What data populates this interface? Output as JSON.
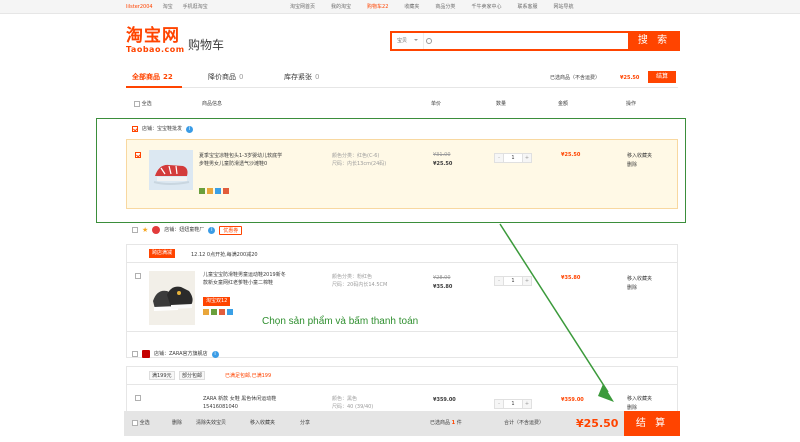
{
  "topbar": {
    "username": "lilster2004",
    "home": "淘宝",
    "mobile": "手机逛淘宝",
    "links": [
      "淘宝网首页",
      "我的淘宝",
      "购物车22",
      "收藏夹",
      "商品分类",
      "千牛卖家中心",
      "联系客服",
      "网站导航"
    ]
  },
  "header": {
    "logo_cn": "淘宝网",
    "logo_en": "Taobao.com",
    "cart_title": "购物车",
    "search_category": "宝贝",
    "search_button": "搜 索"
  },
  "tabs": [
    {
      "label": "全部商品",
      "count": "22"
    },
    {
      "label": "降价商品",
      "count": "0"
    },
    {
      "label": "库存紧张",
      "count": "0"
    }
  ],
  "summary": {
    "label": "已选商品（不含运费）",
    "amount": "¥25.50",
    "pay": "结算"
  },
  "columns": {
    "select_all": "全选",
    "info": "商品信息",
    "price": "单价",
    "qty": "数量",
    "amount": "金额",
    "ops": "操作"
  },
  "stores": [
    {
      "label": "店铺：宝宝鞋批发",
      "coupon": ""
    },
    {
      "label": "店铺：妞妞童鞋厂",
      "coupon": "优惠券"
    },
    {
      "label": "店铺：ZARA官方旗舰店",
      "coupon": ""
    }
  ],
  "promo_banner": {
    "tag": "跨店满减",
    "text": "12.12 0点开抢,每满200减20"
  },
  "items": [
    {
      "name": "夏季宝宝凉鞋包头1-3岁婴幼儿软底学步鞋男女儿童防滑透气沙滩鞋0",
      "props": [
        "颜色分类：红色(C-6)",
        "尺码：内长13cm(24码)"
      ],
      "old_price": "¥31.00",
      "price": "¥25.50",
      "qty": "1",
      "sum": "¥25.50",
      "ops": [
        "移入收藏夹",
        "删除"
      ]
    },
    {
      "name": "儿童宝宝防滑鞋男童运动鞋2019新冬款新女童网红老爹鞋小童二棉鞋",
      "props": [
        "颜色分类：粉红色",
        "尺码：20码内长14.5CM"
      ],
      "old_price": "¥28.00",
      "price": "¥35.80",
      "qty": "1",
      "sum": "¥35.80",
      "badge": "淘宝双12",
      "ops": [
        "移入收藏夹",
        "删除"
      ]
    },
    {
      "name": "ZARA 新款 女鞋 黑色休闲运动鞋 15416081040",
      "props": [
        "颜色：黑色",
        "尺码：40 (39/40)"
      ],
      "old_price": "",
      "price": "¥359.00",
      "qty": "1",
      "sum": "¥359.00",
      "ops": [
        "移入收藏夹",
        "删除"
      ]
    }
  ],
  "zara_promo": {
    "tag1": "满199元",
    "tag2": "部分包邮",
    "note": "已满足包邮,已满199"
  },
  "annotation": "Chọn sản phẩm và bấm thanh toán",
  "footer": {
    "select_all": "全选",
    "delete": "删除",
    "clear_invalid": "清除失效宝贝",
    "move_fav": "移入收藏夹",
    "share": "分享",
    "selected": "已选商品",
    "selected_count": "1",
    "unit": "件",
    "total_label": "合计（不含运费）",
    "total": "¥25.50",
    "pay": "结 算"
  }
}
